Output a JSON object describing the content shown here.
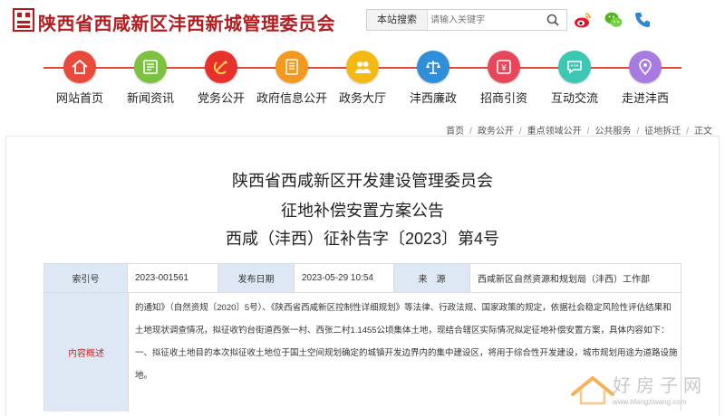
{
  "header": {
    "logo_text": "西",
    "site_title": "陕西省西咸新区沣西新城管理委员会",
    "search_label": "本站搜索",
    "search_placeholder": "请输入关键字"
  },
  "social": [
    "weibo-icon",
    "wechat-icon",
    "phone-icon"
  ],
  "nav": [
    {
      "label": "网站首页",
      "icon": "home-icon",
      "color": "#e94a3c"
    },
    {
      "label": "新闻资讯",
      "icon": "news-icon",
      "color": "#7cc23f"
    },
    {
      "label": "党务公开",
      "icon": "party-icon",
      "color": "#e6312c"
    },
    {
      "label": "政府信息公开",
      "icon": "document-icon",
      "color": "#f39a1e"
    },
    {
      "label": "政务大厅",
      "icon": "people-icon",
      "color": "#f5b914"
    },
    {
      "label": "沣西廉政",
      "icon": "scales-icon",
      "color": "#2f8fd8"
    },
    {
      "label": "招商引资",
      "icon": "investment-icon",
      "color": "#e8475b"
    },
    {
      "label": "互动交流",
      "icon": "chat-icon",
      "color": "#3cc6b4"
    },
    {
      "label": "走进沣西",
      "icon": "location-icon",
      "color": "#a87be0"
    }
  ],
  "breadcrumb": [
    "首页",
    "政务公开",
    "重点领域公开",
    "公共服务",
    "征地拆迁",
    "正文"
  ],
  "breadcrumb_sep": "/",
  "article": {
    "title_line1": "陕西省西咸新区开发建设管理委员会",
    "title_line2": "征地补偿安置方案公告",
    "title_line3": "西咸（沣西）征补告字〔2023〕第4号"
  },
  "info": {
    "index_label": "索引号",
    "index_value": "2023-001561",
    "date_label": "发布日期",
    "date_value": "2023-05-29 10:54",
    "source_label": "来　源",
    "source_value": "西咸新区自然资源和规划局（沣西）工作部",
    "summary_label": "内容概述",
    "summary_lines": [
      "的通知》（自然资规〔2020〕5号）、《陕西省西咸新区控制性详细规划》等法律、行政法规、国家政策的规定，依据社会稳定风险性评估结果和",
      "土地现状调查情况，拟征收钓台街道西张一村、西张二村1.1455公顷集体土地，现结合辖区实际情况拟定征地补偿安置方案，具体内容如下：",
      "一、拟征收土地目的本次拟征收土地位于国土空间规划确定的城镇开发边界内的集中建设区，将用于综合性开发建设，城市规划用途为道路设施用",
      "地。"
    ]
  },
  "watermark": {
    "text": "好房子网",
    "url": "www.hfangziwang.com"
  }
}
